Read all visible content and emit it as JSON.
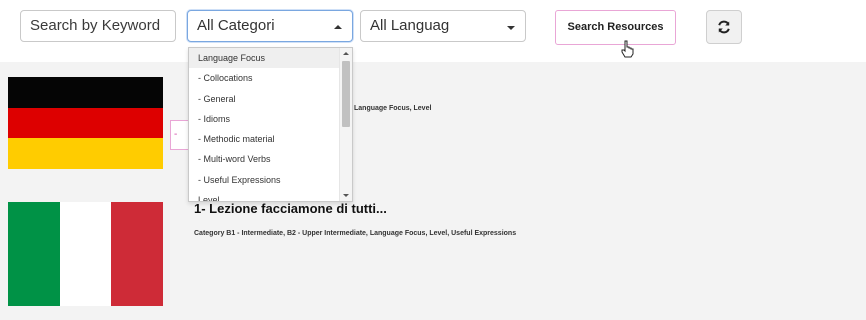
{
  "filters": {
    "keyword": "Search by Keyword",
    "category_value": "All Categori",
    "language_value": "All Languag",
    "search_label": "Search Resources",
    "refresh_icon": "refresh-icon"
  },
  "dropdown": {
    "options": [
      "Language Focus",
      "- Collocations",
      "- General",
      "- Idioms",
      "- Methodic material",
      "- Multi-word Verbs",
      "- Useful Expressions",
      "Level"
    ]
  },
  "results": [
    {
      "flag": "german-flag",
      "title": "",
      "categories": "Language Focus, Level",
      "button_fragment": "-"
    },
    {
      "flag": "italian-flag",
      "title": "1- Lezione facciamone di tutti...",
      "categories": "Category B1 - Intermediate, B2 - Upper Intermediate, Language Focus, Level, Useful Expressions"
    }
  ],
  "colors": {
    "accent_border": "#e9a6d6",
    "focus_border": "#7aa7e0",
    "results_bg": "#f3f3f3"
  }
}
